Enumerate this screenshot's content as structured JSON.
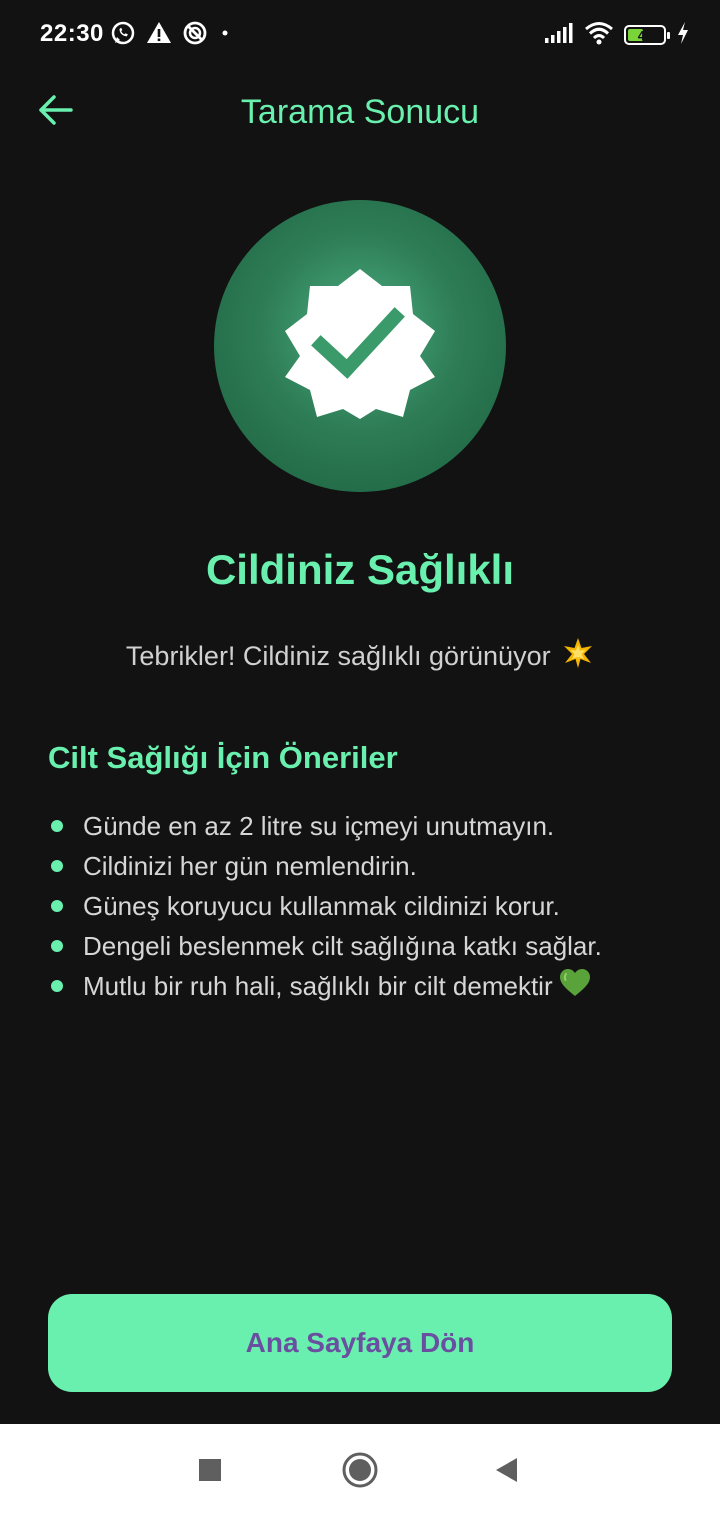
{
  "status_bar": {
    "time": "22:30",
    "battery_level": "42",
    "icons": [
      "whatsapp-icon",
      "warning-icon",
      "no-disturb-icon",
      "dot-icon",
      "signal-icon",
      "wifi-icon",
      "battery-icon",
      "charging-icon"
    ]
  },
  "app_bar": {
    "title": "Tarama Sonucu",
    "back_icon": "arrow-left-icon",
    "accent_color": "#69f0ae"
  },
  "result": {
    "icon": "verified-badge-icon",
    "title": "Cildiniz Sağlıklı",
    "subtitle": "Tebrikler! Cildiniz sağlıklı görünüyor",
    "subtitle_emoji": "star-icon"
  },
  "tips": {
    "title": "Cilt Sağlığı İçin Öneriler",
    "items": [
      "Günde en az 2 litre su içmeyi unutmayın.",
      "Cildinizi her gün nemlendirin.",
      "Güneş koruyucu kullanmak cildinizi korur.",
      "Dengeli beslenmek cilt sağlığına katkı sağlar.",
      "Mutlu bir ruh hali, sağlıklı bir cilt demektir"
    ],
    "last_item_emoji": "green-heart-icon"
  },
  "actions": {
    "home_label": "Ana Sayfaya Dön",
    "button_color": "#69f0ae",
    "label_color": "#6a4fa0"
  },
  "nav_bar": {
    "items": [
      "recents-button",
      "home-button",
      "back-button"
    ]
  }
}
